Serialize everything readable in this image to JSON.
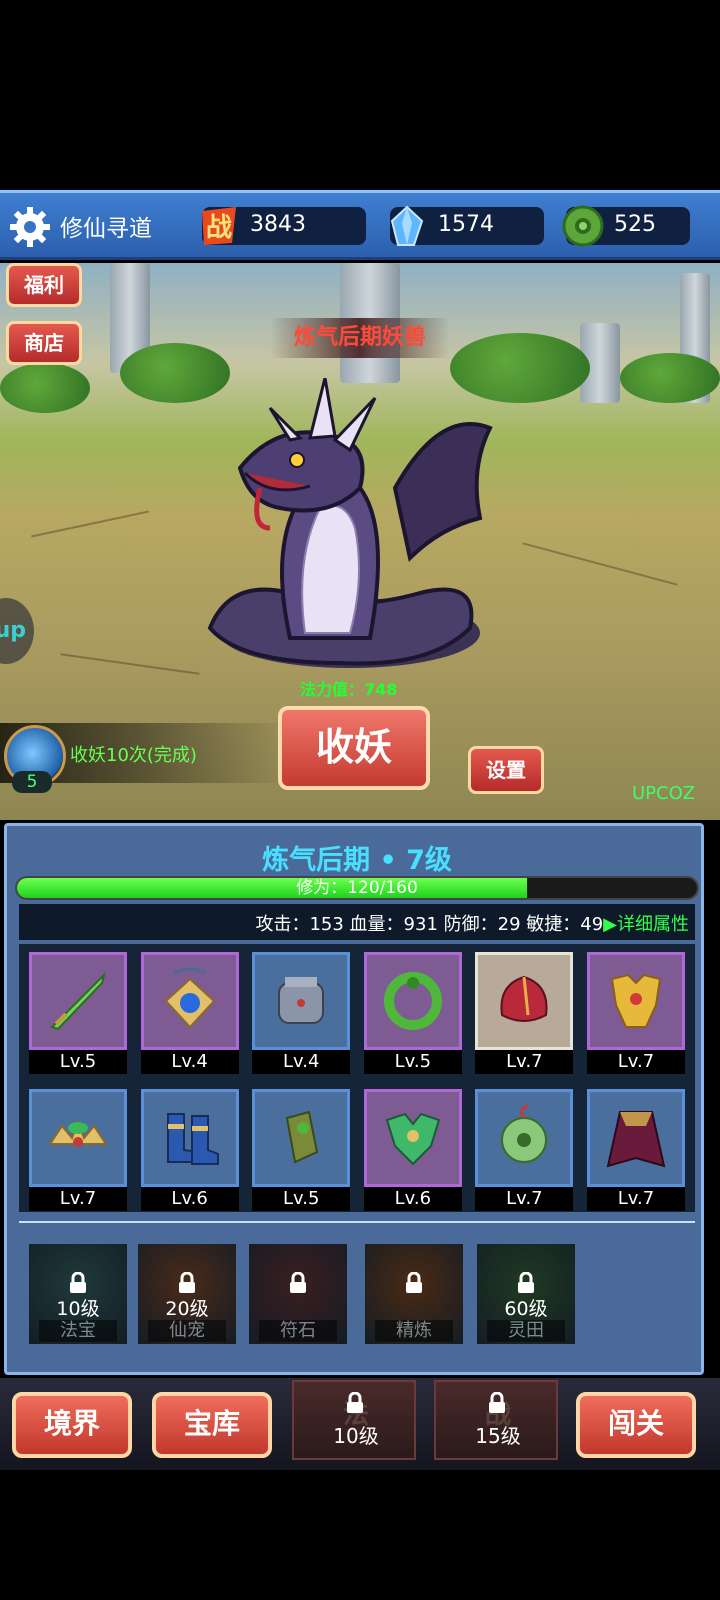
{
  "header": {
    "title": "修仙寻道",
    "battle_power": "3843",
    "crystals": "1574",
    "jade": "525",
    "battle_icon_char": "战"
  },
  "scene": {
    "welfare_label": "福利",
    "shop_label": "商店",
    "enemy_name": "炼气后期妖兽",
    "power_text": "法力值：748",
    "quest_text": "收妖10次(完成)",
    "potion_count": "5",
    "catch_label": "收妖",
    "settings_label": "设置",
    "side_tab_text": "up",
    "watermark": "UPCOZ"
  },
  "status": {
    "realm": "炼气后期 • 7级",
    "cultivation_text": "修为：120/160",
    "cultivation_progress": 0.75,
    "stats_line": "攻击：153   血量：931   防御：29   敏捷：49",
    "detail_link": "▶详细属性"
  },
  "equipment": [
    {
      "level": "Lv.5",
      "icon": "jade-sword-icon",
      "rarity": "purple"
    },
    {
      "level": "Lv.4",
      "icon": "amulet-icon",
      "rarity": "purple"
    },
    {
      "level": "Lv.4",
      "icon": "gauntlet-icon",
      "rarity": "blue"
    },
    {
      "level": "Lv.5",
      "icon": "jade-ring-icon",
      "rarity": "purple"
    },
    {
      "level": "Lv.7",
      "icon": "red-helmet-icon",
      "rarity": "white"
    },
    {
      "level": "Lv.7",
      "icon": "gold-armor-icon",
      "rarity": "purple"
    },
    {
      "level": "Lv.7",
      "icon": "crown-icon",
      "rarity": "blue"
    },
    {
      "level": "Lv.6",
      "icon": "boots-icon",
      "rarity": "blue"
    },
    {
      "level": "Lv.5",
      "icon": "bracer-icon",
      "rarity": "blue"
    },
    {
      "level": "Lv.6",
      "icon": "green-armor-icon",
      "rarity": "purple"
    },
    {
      "level": "Lv.7",
      "icon": "jade-pendant-icon",
      "rarity": "blue"
    },
    {
      "level": "Lv.7",
      "icon": "cloak-icon",
      "rarity": "blue"
    }
  ],
  "locked_features": [
    {
      "req": "10级",
      "name": "法宝"
    },
    {
      "req": "20级",
      "name": "仙宠"
    },
    {
      "req": "",
      "name": "符石"
    },
    {
      "req": "",
      "name": "精炼"
    },
    {
      "req": "60级",
      "name": "灵田"
    }
  ],
  "bottom_nav": {
    "realm": "境界",
    "treasury": "宝库",
    "locked1_ghost": "法",
    "locked1_req": "10级",
    "locked2_ghost": "战",
    "locked2_req": "15级",
    "challenge": "闯关"
  },
  "colors": {
    "rarity_purple": "#b067d8",
    "rarity_blue": "#5b8fd9",
    "rarity_white": "#e8e4d8",
    "accent_green": "#33ff4a",
    "realm_cyan": "#49e0ff"
  }
}
